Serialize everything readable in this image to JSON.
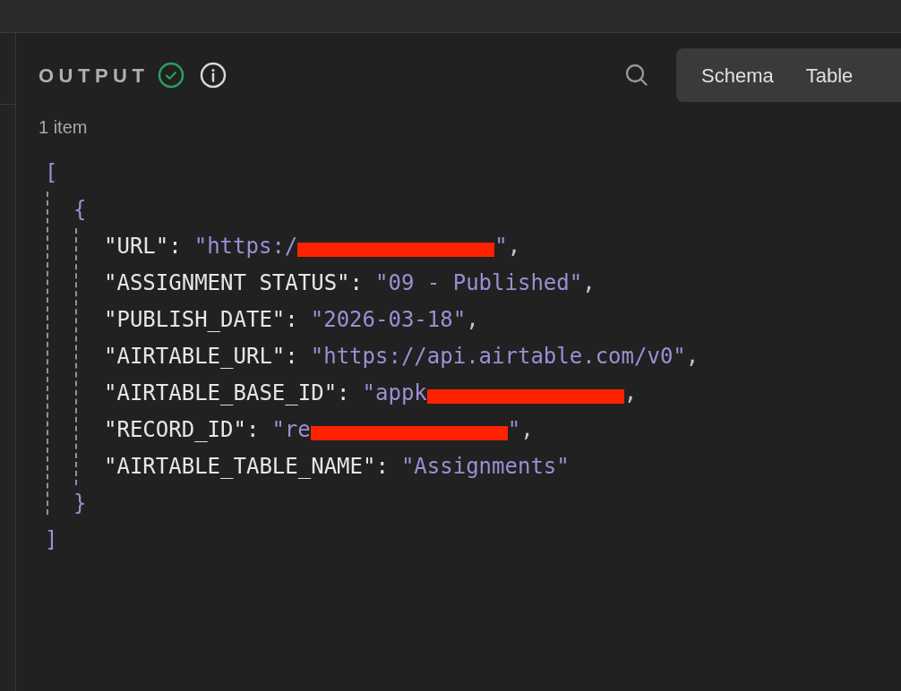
{
  "header": {
    "title": "OUTPUT"
  },
  "view_tabs": [
    {
      "label": "Schema"
    },
    {
      "label": "Table"
    }
  ],
  "item_count": "1 item",
  "json": {
    "open_array": "[",
    "open_object": "{",
    "close_object": "}",
    "close_array": "]",
    "fields": [
      {
        "key": "\"URL\":",
        "value": "\"https:/",
        "redacted": true,
        "value_end": "\"",
        "comma": ","
      },
      {
        "key": "\"ASSIGNMENT STATUS\":",
        "value": "\"09 - Published\"",
        "redacted": false,
        "comma": ","
      },
      {
        "key": "\"PUBLISH_DATE\":",
        "value": "\"2026-03-18\"",
        "redacted": false,
        "comma": ","
      },
      {
        "key": "\"AIRTABLE_URL\":",
        "value": "\"https://api.airtable.com/v0\"",
        "redacted": false,
        "comma": ","
      },
      {
        "key": "\"AIRTABLE_BASE_ID\":",
        "value": "\"appk",
        "redacted": true,
        "comma": ","
      },
      {
        "key": "\"RECORD_ID\":",
        "value": "\"re",
        "redacted": true,
        "value_end": "\"",
        "comma": ","
      },
      {
        "key": "\"AIRTABLE_TABLE_NAME\":",
        "value": "\"Assignments\"",
        "redacted": false
      }
    ]
  }
}
